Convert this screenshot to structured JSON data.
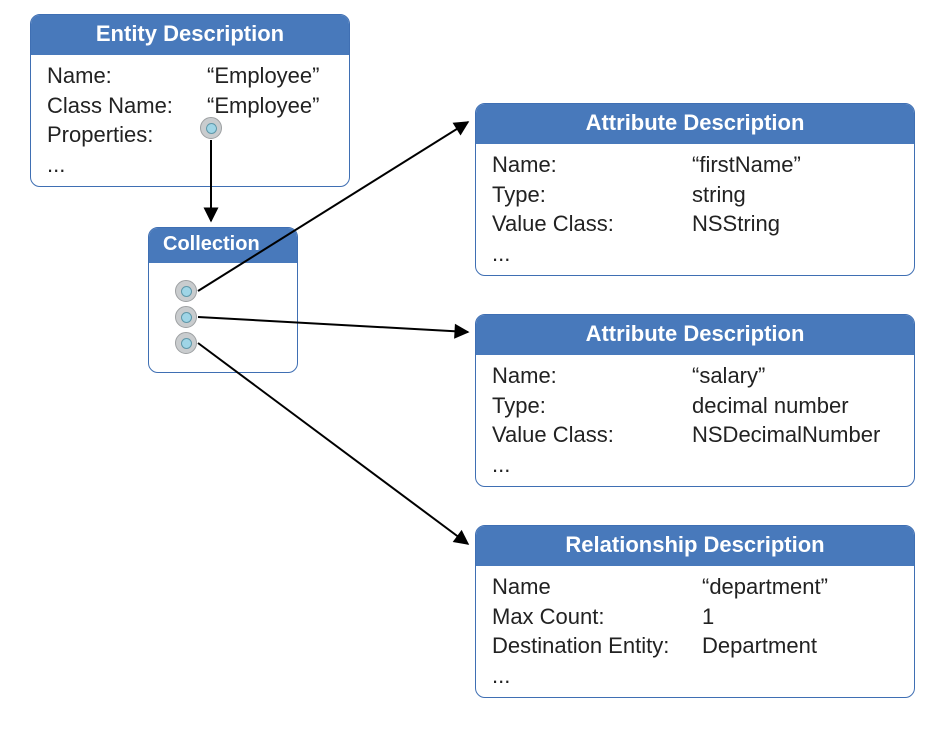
{
  "entity": {
    "title": "Entity Description",
    "labels": {
      "name": "Name:",
      "className": "Class Name:",
      "properties": "Properties:"
    },
    "values": {
      "name": "“Employee”",
      "className": "“Employee”"
    },
    "ellipsis": "..."
  },
  "collection": {
    "title": "Collection"
  },
  "attr1": {
    "title": "Attribute Description",
    "labels": {
      "name": "Name:",
      "type": "Type:",
      "valueClass": "Value Class:"
    },
    "values": {
      "name": "“firstName”",
      "type": "string",
      "valueClass": "NSString"
    },
    "ellipsis": "..."
  },
  "attr2": {
    "title": "Attribute Description",
    "labels": {
      "name": "Name:",
      "type": "Type:",
      "valueClass": "Value Class:"
    },
    "values": {
      "name": "“salary”",
      "type": "decimal number",
      "valueClass": "NSDecimalNumber"
    },
    "ellipsis": "..."
  },
  "rel": {
    "title": "Relationship Description",
    "labels": {
      "name": "Name",
      "maxCount": "Max Count:",
      "destEntity": "Destination Entity:"
    },
    "values": {
      "name": "“department”",
      "maxCount": "1",
      "destEntity": "Department"
    },
    "ellipsis": "..."
  }
}
